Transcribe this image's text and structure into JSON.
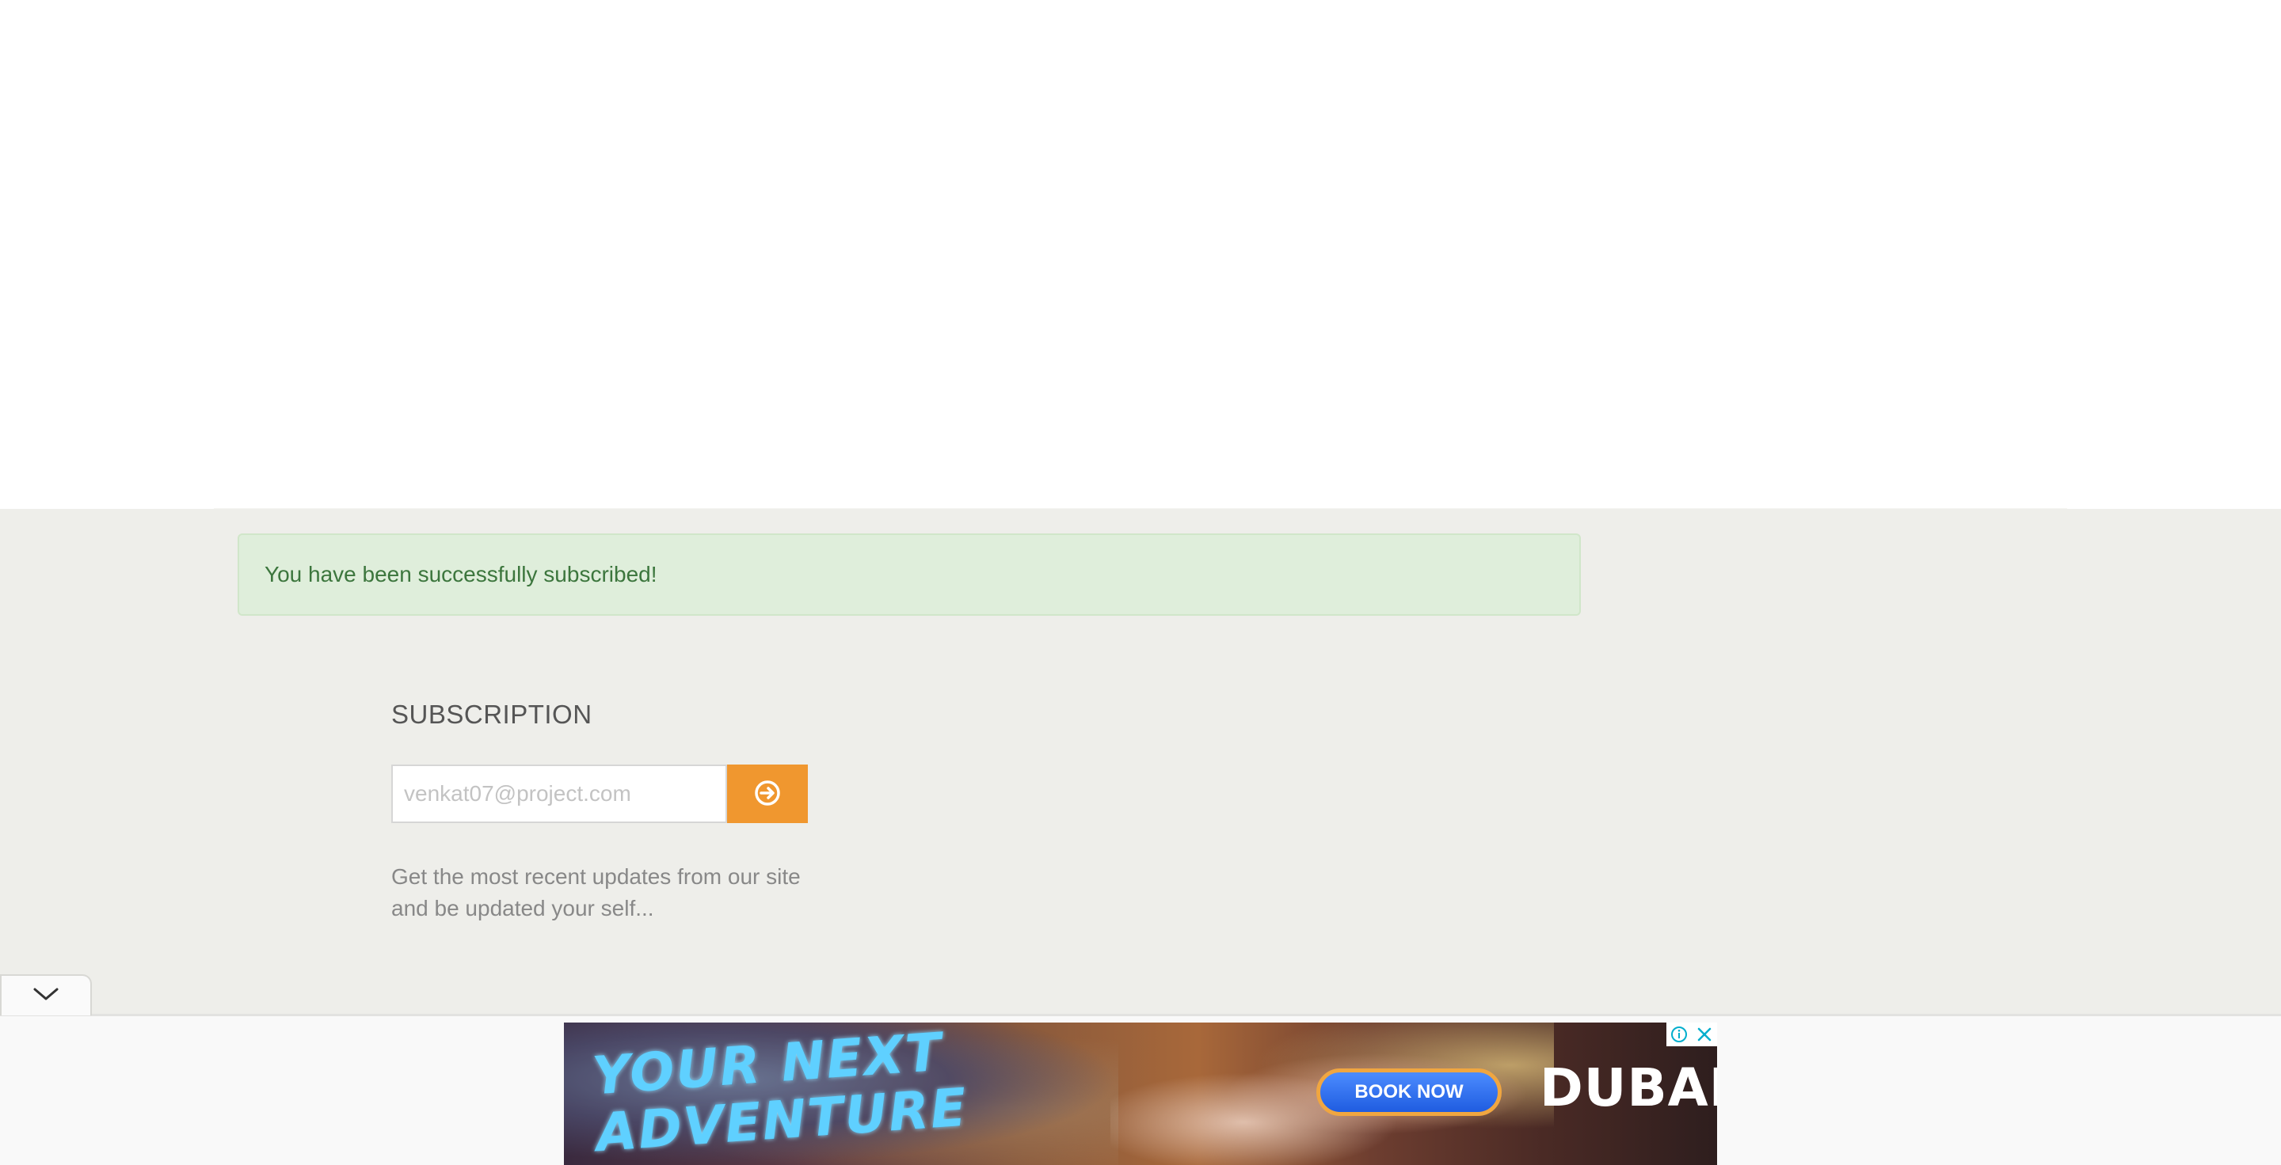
{
  "alert": {
    "message": "You have been successfully subscribed!"
  },
  "subscription": {
    "title": "SUBSCRIPTION",
    "email_placeholder": "venkat07@project.com",
    "submit_icon": "arrow-circle-right-icon",
    "description": "Get the most recent updates from our site and be updated your self..."
  },
  "collapse_tab": {
    "icon": "chevron-down-icon"
  },
  "ad": {
    "headline": "YOUR NEXT\nADVENTURE",
    "cta_label": "BOOK NOW",
    "brand": "DUBAI",
    "info_icon": "info-icon",
    "close_icon": "close-icon"
  },
  "colors": {
    "accent_orange": "#f0972f",
    "success_bg": "#dfeedb",
    "success_text": "#3c763d",
    "footer_bg": "#eeeeea"
  }
}
